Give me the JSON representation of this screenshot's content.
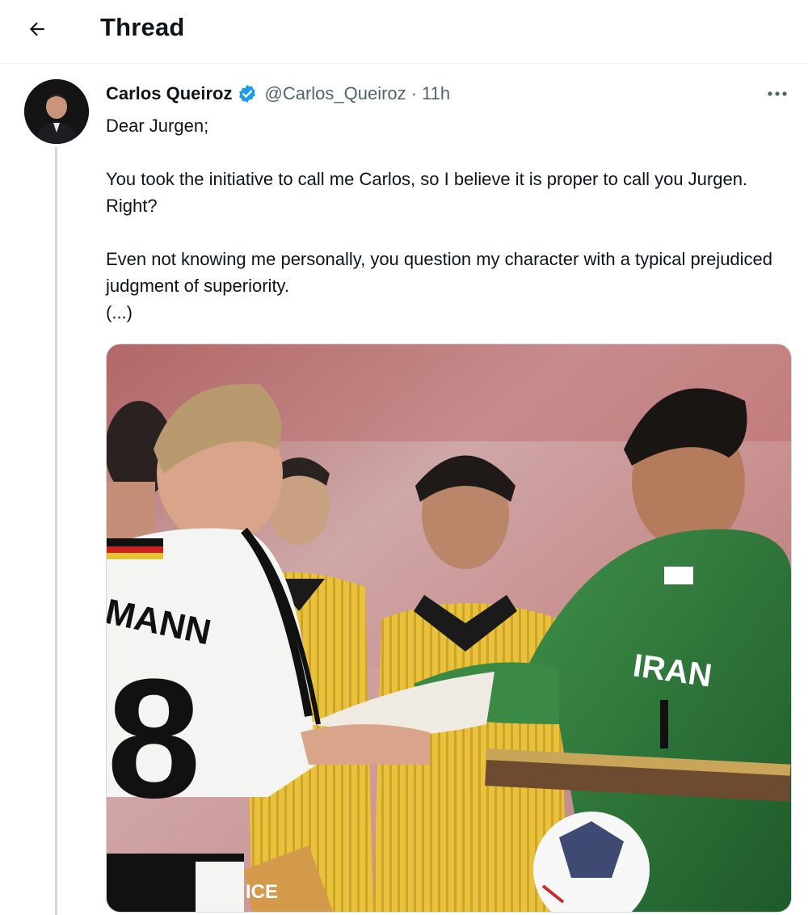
{
  "header": {
    "title": "Thread",
    "back_icon": "arrow-left-icon"
  },
  "tweet": {
    "display_name": "Carlos Queiroz",
    "verified_icon": "verified-badge-icon",
    "handle": "@Carlos_Queiroz",
    "separator": "·",
    "time": "11h",
    "more_icon": "more-dots-icon",
    "lines": [
      "Dear Jurgen;",
      "You took the initiative to call me Carlos, so I believe it is proper to call you Jurgen. Right?",
      "Even not knowing me personally, you question my character with a typical prejudiced judgment of superiority.",
      "(...)"
    ],
    "media": {
      "jersey_name": "MANN",
      "jersey_number": "8",
      "keeper_crest": "IRAN",
      "sponsor_text": "ICE"
    }
  },
  "colors": {
    "verified_blue": "#1d9bf0",
    "secondary_text": "#536471",
    "keeper_green": "#2f7a3c",
    "referee_yellow": "#e8c233"
  }
}
